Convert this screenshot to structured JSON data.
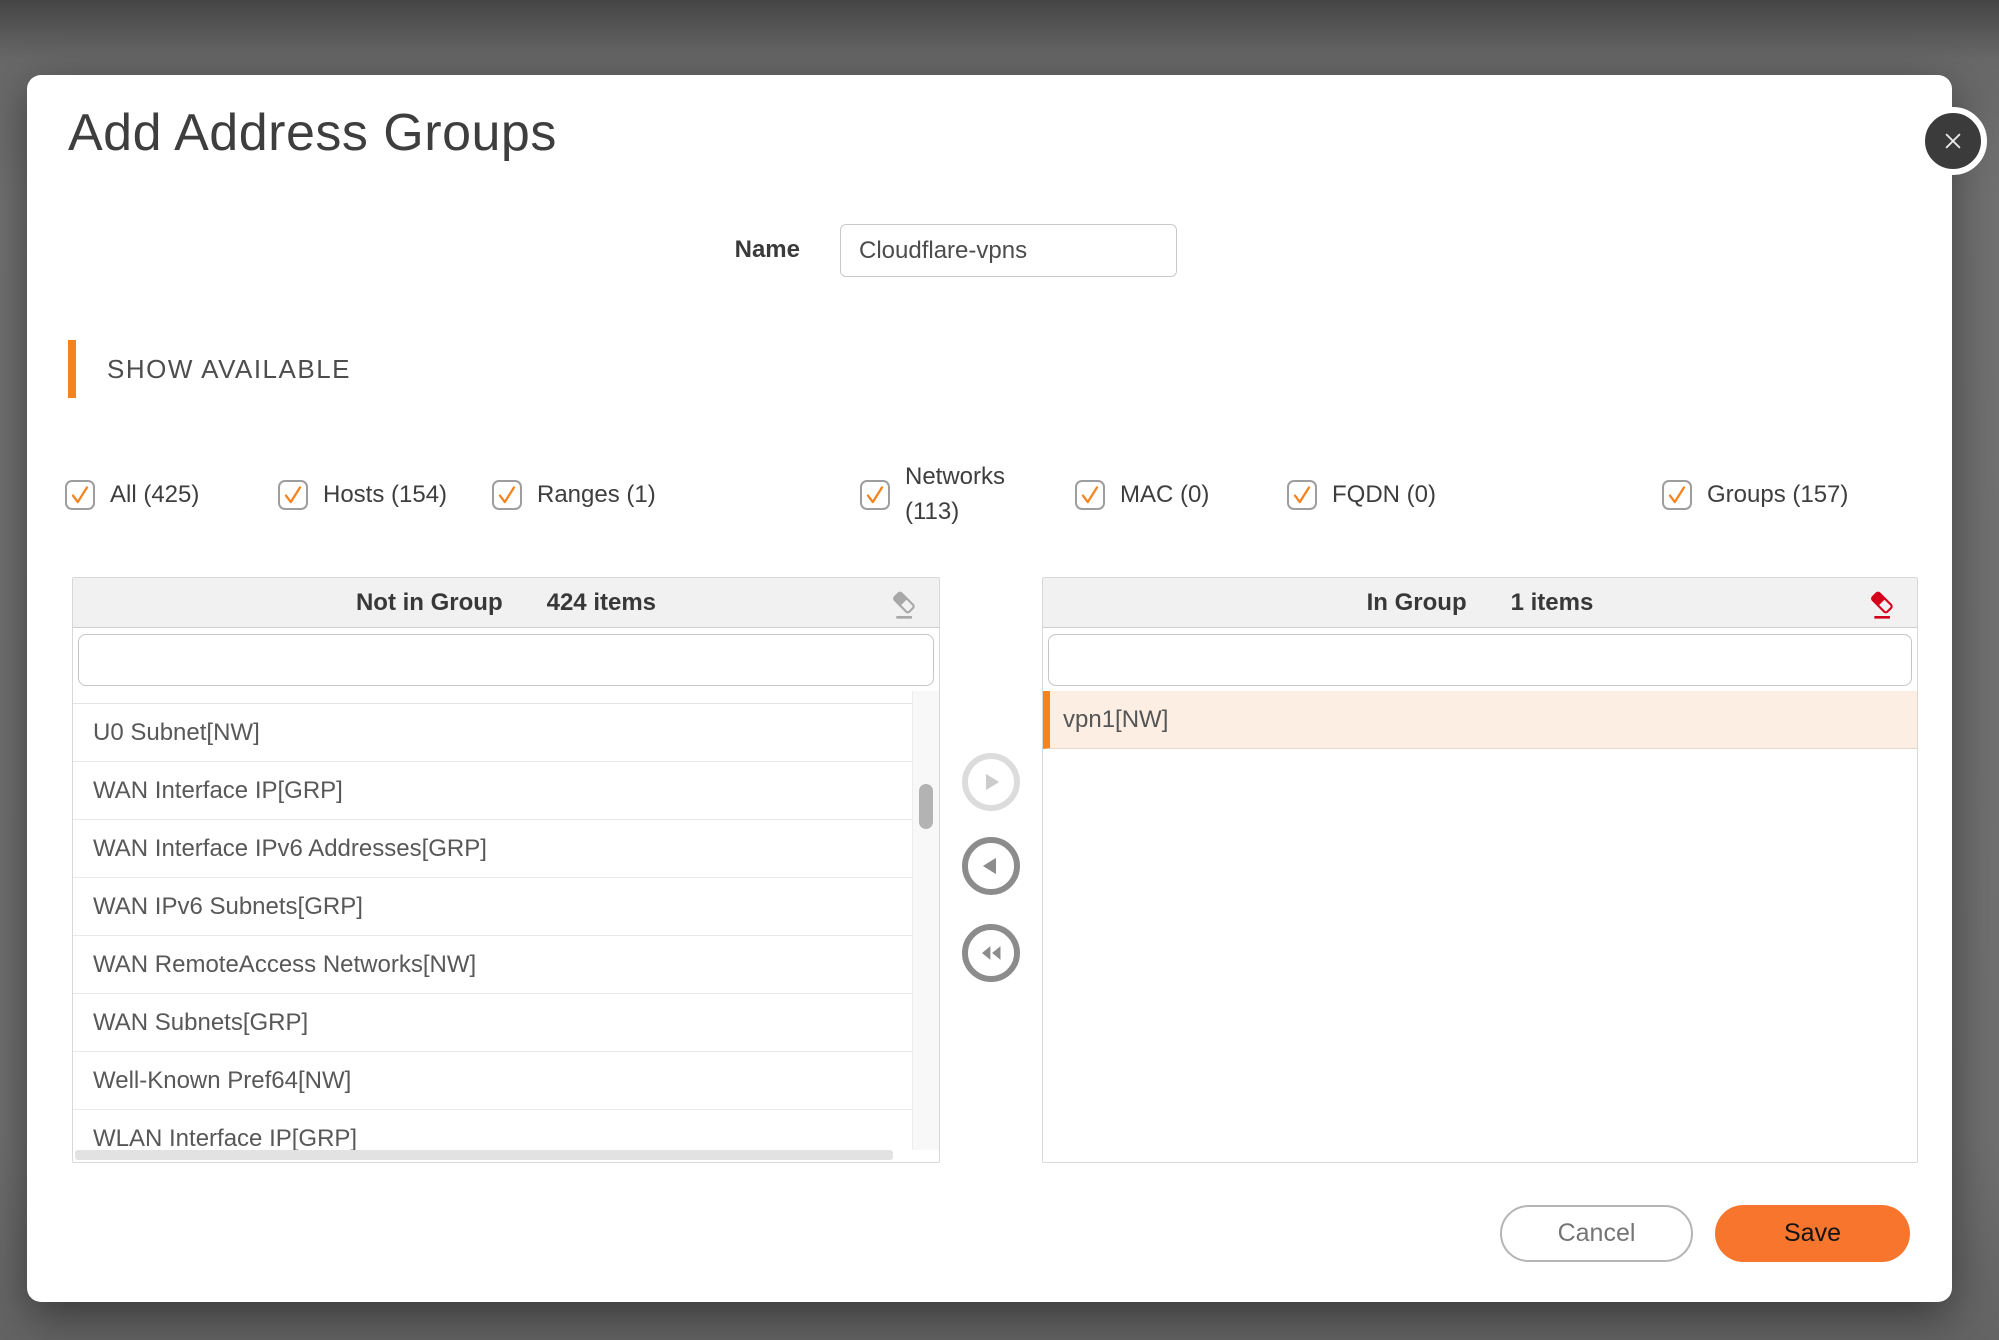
{
  "dialog": {
    "title": "Add Address Groups"
  },
  "name_field": {
    "label": "Name",
    "value": "Cloudflare-vpns"
  },
  "section": {
    "label": "SHOW AVAILABLE"
  },
  "filters": [
    {
      "label": "All (425)",
      "checked": true
    },
    {
      "label": "Hosts (154)",
      "checked": true
    },
    {
      "label": "Ranges (1)",
      "checked": true
    },
    {
      "label": "Networks (113)",
      "checked": true
    },
    {
      "label": "MAC (0)",
      "checked": true
    },
    {
      "label": "FQDN (0)",
      "checked": true
    },
    {
      "label": "Groups (157)",
      "checked": true
    }
  ],
  "left_panel": {
    "title": "Not in Group",
    "count": "424 items",
    "search_value": "",
    "items": [
      "U0 Subnet[NW]",
      "WAN Interface IP[GRP]",
      "WAN Interface IPv6 Addresses[GRP]",
      "WAN IPv6 Subnets[GRP]",
      "WAN RemoteAccess Networks[NW]",
      "WAN Subnets[GRP]",
      "Well-Known Pref64[NW]",
      "WLAN Interface IP[GRP]"
    ]
  },
  "right_panel": {
    "title": "In Group",
    "count": "1 items",
    "search_value": "",
    "items": [
      {
        "label": "vpn1[NW]",
        "selected": true
      }
    ]
  },
  "actions": {
    "cancel": "Cancel",
    "save": "Save"
  },
  "colors": {
    "accent_orange": "#F5841F",
    "save_button": "#F7752C",
    "eraser_red": "#D6001C",
    "selected_row_bg": "#FCEEE3",
    "dialog_bg": "#FFFFFF",
    "backdrop": "#6F6F6F"
  }
}
